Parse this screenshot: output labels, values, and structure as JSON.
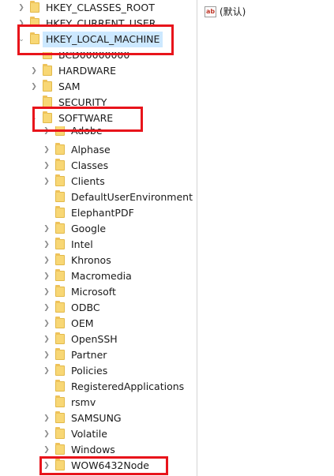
{
  "registry_tree": {
    "root_keys": {
      "classes_root": "HKEY_CLASSES_ROOT",
      "current_user": "HKEY_CURRENT_USER",
      "local_machine": "HKEY_LOCAL_MACHINE"
    },
    "local_machine_children": {
      "bcd": "BCD00000000",
      "hardware": "HARDWARE",
      "sam": "SAM",
      "security": "SECURITY",
      "software": "SOFTWARE"
    },
    "software_children": [
      "Adobe",
      "Alphase",
      "Classes",
      "Clients",
      "DefaultUserEnvironment",
      "ElephantPDF",
      "Google",
      "Intel",
      "Khronos",
      "Macromedia",
      "Microsoft",
      "ODBC",
      "OEM",
      "OpenSSH",
      "Partner",
      "Policies",
      "RegisteredApplications",
      "rsmv",
      "SAMSUNG",
      "Volatile",
      "Windows",
      "WOW6432Node"
    ],
    "icons": {
      "folder": "folder-icon",
      "expand": "chevron-right-icon",
      "expanded": "chevron-down-icon"
    }
  },
  "values_pane": {
    "default_value_name": "(默认)",
    "value_type_icon": "string-value-icon",
    "value_type_icon_text": "ab"
  },
  "colors": {
    "annotation_box": "#e8141b",
    "folder_fill": "#f8d775",
    "selection": "#cce8ff"
  }
}
